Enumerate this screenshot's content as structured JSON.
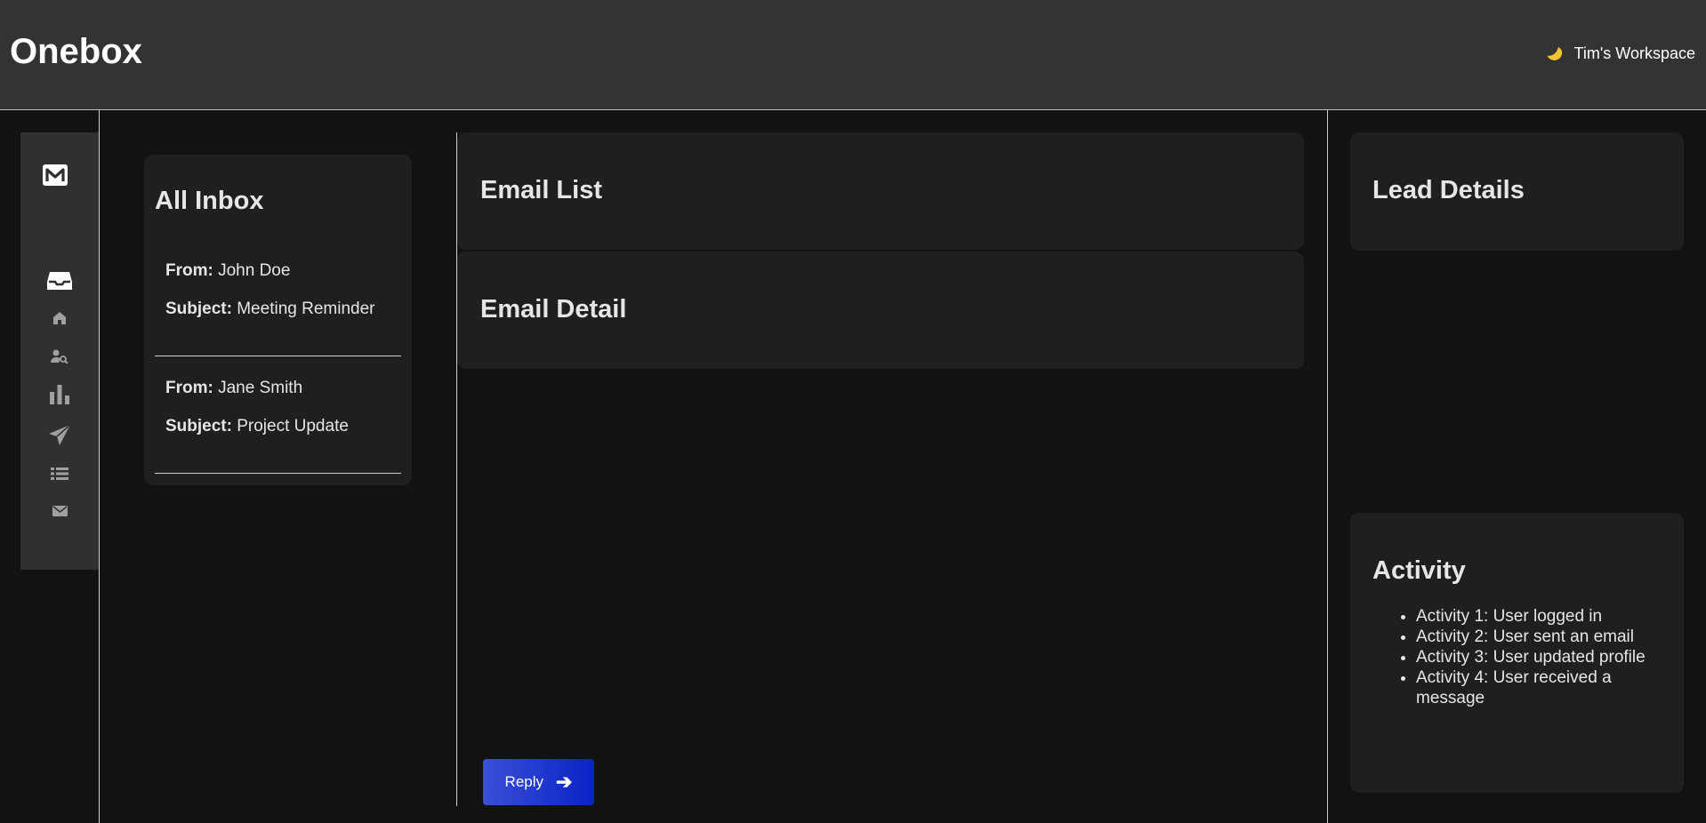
{
  "app": {
    "title": "Onebox",
    "workspace_label": "Tim's Workspace"
  },
  "icons": {
    "logo": "gmail-m-icon",
    "theme_toggle": "moon-icon",
    "sidebar": [
      "inbox-icon",
      "home-icon",
      "user-search-icon",
      "bar-chart-icon",
      "send-icon",
      "list-icon",
      "mail-icon"
    ],
    "reply": "arrow-right-icon"
  },
  "colors": {
    "header_bg": "#333333",
    "page_bg": "#121212",
    "panel_bg": "#1f1f1f",
    "button_gradient_start": "#3950d6",
    "button_gradient_end": "#0b22c6",
    "moon": "#f2c230"
  },
  "inbox": {
    "title": "All Inbox",
    "from_label": "From:",
    "subject_label": "Subject:",
    "emails": [
      {
        "from": "John Doe",
        "subject": "Meeting Reminder"
      },
      {
        "from": "Jane Smith",
        "subject": "Project Update"
      }
    ]
  },
  "email_list": {
    "title": "Email List"
  },
  "email_detail": {
    "title": "Email Detail"
  },
  "reply": {
    "label": "Reply"
  },
  "lead_details": {
    "title": "Lead Details"
  },
  "activity": {
    "title": "Activity",
    "items": [
      "Activity 1: User logged in",
      "Activity 2: User sent an email",
      "Activity 3: User updated profile",
      "Activity 4: User received a message"
    ]
  }
}
